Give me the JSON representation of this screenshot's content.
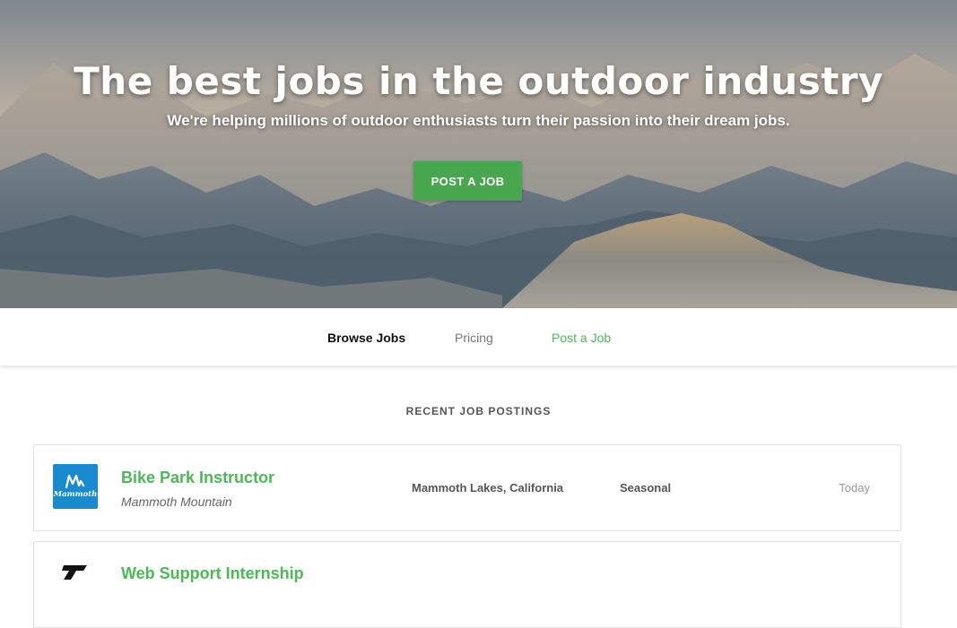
{
  "hero": {
    "title": "The best jobs in the outdoor industry",
    "subtitle": "We're helping millions of outdoor enthusiasts turn their passion into their dream jobs.",
    "cta_label": "POST A JOB"
  },
  "nav": {
    "items": [
      {
        "label": "Browse Jobs"
      },
      {
        "label": "Pricing"
      },
      {
        "label": "Post a Job"
      }
    ]
  },
  "section": {
    "title": "RECENT JOB POSTINGS"
  },
  "jobs": [
    {
      "title": "Bike Park Instructor",
      "company": "Mammoth Mountain",
      "location": "Mammoth Lakes, California",
      "type": "Seasonal",
      "posted": "Today",
      "logo_text": "Mammoth",
      "logo_color": "#1a8ad0"
    },
    {
      "title": "Web Support Internship",
      "company": "",
      "location": "",
      "type": "",
      "posted": "",
      "logo_color": "#111111"
    }
  ],
  "colors": {
    "accent_green": "#4cb957",
    "button_green": "#47a64e"
  }
}
